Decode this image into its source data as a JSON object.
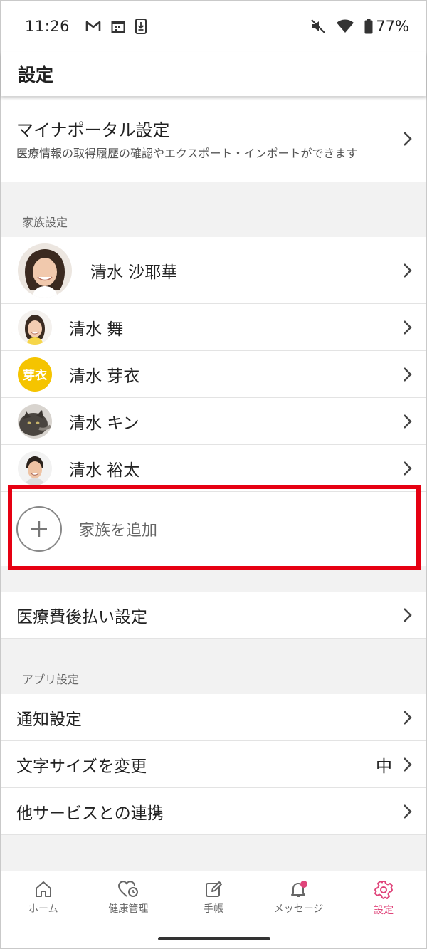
{
  "status_bar": {
    "time": "11:26",
    "battery": "77%",
    "icons": [
      "gmail-icon",
      "calendar-icon",
      "download-icon",
      "mute-icon",
      "wifi-icon",
      "battery-icon"
    ]
  },
  "header": {
    "title": "設定"
  },
  "myna_portal": {
    "title": "マイナポータル設定",
    "subtitle": "医療情報の取得履歴の確認やエクスポート・インポートができます"
  },
  "family": {
    "section_label": "家族設定",
    "members": [
      {
        "name": "清水 沙耶華",
        "avatar": "photo-woman"
      },
      {
        "name": "清水 舞",
        "avatar": "photo-girl"
      },
      {
        "name": "清水 芽衣",
        "avatar": "initials",
        "initials": "芽衣",
        "color": "#f5c400"
      },
      {
        "name": "清水 キン",
        "avatar": "photo-cat"
      },
      {
        "name": "清水 裕太",
        "avatar": "photo-man"
      }
    ],
    "add_label": "家族を追加",
    "highlight_color": "#e60012"
  },
  "payment": {
    "label": "医療費後払い設定"
  },
  "app_settings": {
    "section_label": "アプリ設定",
    "items": [
      {
        "label": "通知設定",
        "value": ""
      },
      {
        "label": "文字サイズを変更",
        "value": "中"
      },
      {
        "label": "他サービスとの連携",
        "value": ""
      }
    ]
  },
  "bottom_nav": {
    "items": [
      {
        "label": "ホーム",
        "icon": "home-icon"
      },
      {
        "label": "健康管理",
        "icon": "health-icon"
      },
      {
        "label": "手帳",
        "icon": "notebook-icon"
      },
      {
        "label": "メッセージ",
        "icon": "bell-icon"
      },
      {
        "label": "設定",
        "icon": "gear-icon"
      }
    ],
    "active_index": 4,
    "accent_color": "#e0457b"
  }
}
